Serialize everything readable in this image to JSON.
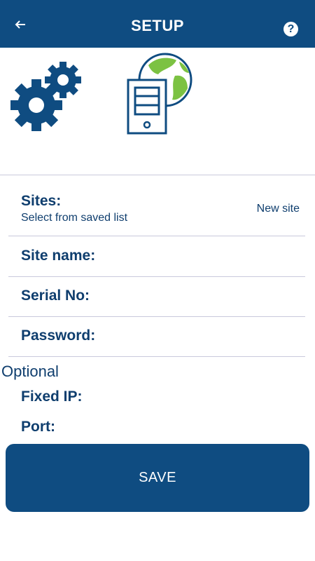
{
  "header": {
    "title": "SETUP",
    "back_icon": "arrow-left-icon",
    "help_icon": "question-circle-icon",
    "help_glyph": "?"
  },
  "illustration": {
    "left_icon": "gears-icon",
    "right_icon": "server-globe-icon"
  },
  "colors": {
    "primary": "#0f4c81",
    "text": "#0f3e6e",
    "divider": "#c9c9dc",
    "globe_green": "#7cc242"
  },
  "form": {
    "sites_label": "Sites:",
    "sites_sub": "Select from saved list",
    "new_site": "New site",
    "site_name_label": "Site name:",
    "serial_label": "Serial No:",
    "password_label": "Password:",
    "optional_label": "Optional",
    "fixed_ip_label": "Fixed IP:",
    "port_label": "Port:"
  },
  "save_label": "SAVE"
}
